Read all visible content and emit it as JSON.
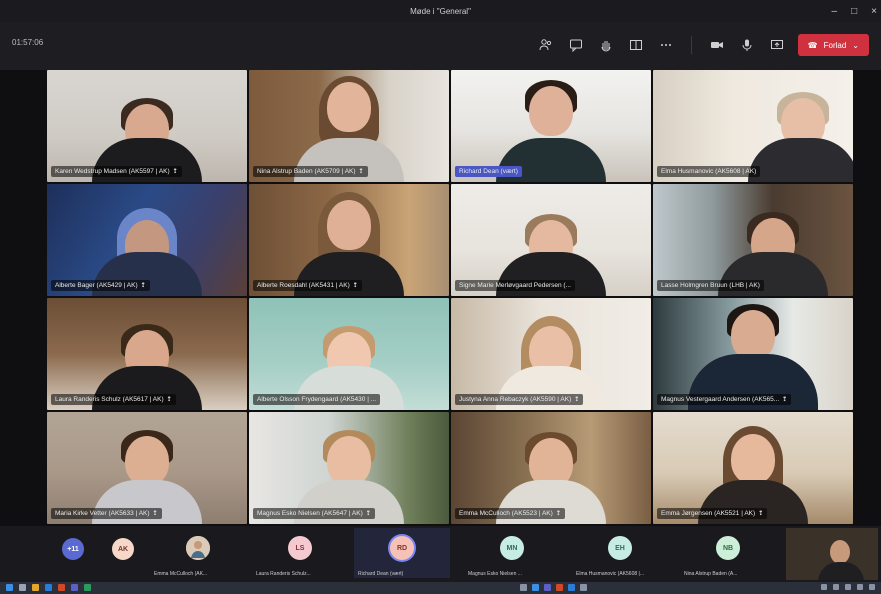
{
  "window": {
    "title": "Møde i \"General\""
  },
  "meeting": {
    "timer": "01:57:06",
    "leave_label": "Forlad"
  },
  "colors": {
    "leave": "#d0313f",
    "active_label": "#4a56c4"
  },
  "tiles": [
    {
      "label": "Karen Wedstrup Madsen (AK5597 | AK)"
    },
    {
      "label": "Nina Alstrup Baden (AK5709 | AK)"
    },
    {
      "label": "Richard Dean (vært)"
    },
    {
      "label": "Elma Husmanovic (AK5608 | AK)"
    },
    {
      "label": "Alberte Bager (AK5429 | AK)"
    },
    {
      "label": "Alberte Roesdahl (AK5431 | AK)"
    },
    {
      "label": "Signe Marie Merløvgaard Pedersen (..."
    },
    {
      "label": "Lasse Holmgren Bruun (LHB | AK)"
    },
    {
      "label": "Laura Randeris Schulz (AK5617 | AK)"
    },
    {
      "label": "Alberte Olsson Frydengaard (AK5430 | ..."
    },
    {
      "label": "Justyna Anna Rebaczyk (AK5590 | AK)"
    },
    {
      "label": "Magnus Vestergaard Andersen (AK565..."
    },
    {
      "label": "Maria Kirke Vetter (AK5633 | AK)"
    },
    {
      "label": "Magnus Esko Nielsen (AK5647 | AK)"
    },
    {
      "label": "Emma McCulloch (AK5523 | AK)"
    },
    {
      "label": "Emma Jørgensen (AK5521 | AK)"
    }
  ],
  "strip": {
    "more": "+11",
    "ak": "AK",
    "slots": [
      {
        "initials": "",
        "name": "Emma McCulloch (AK..."
      },
      {
        "initials": "LS",
        "name": "Laura Randeris Schulz..."
      },
      {
        "initials": "RD",
        "name": "Richard Dean (vært)"
      },
      {
        "initials": "MN",
        "name": "Magnus Esko Nielsen ..."
      },
      {
        "initials": "EH",
        "name": "Elma Husmanovic (AK5608 |..."
      },
      {
        "initials": "NB",
        "name": "Nina Alstrup Baden (A..."
      }
    ]
  }
}
